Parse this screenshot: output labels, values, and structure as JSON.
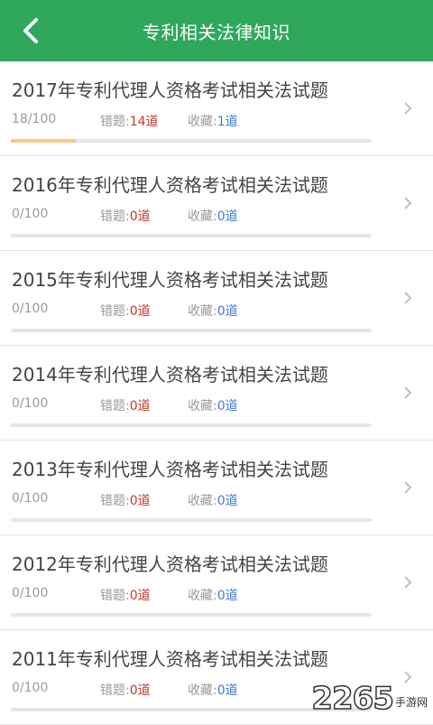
{
  "header": {
    "title": "专利相关法律知识",
    "back_icon": "chevron-left-icon",
    "background_color": "#2fa85c"
  },
  "labels": {
    "wrong": "错题:",
    "fav": "收藏:"
  },
  "items": [
    {
      "title": "2017年专利代理人资格考试相关法试题",
      "progress_text": "18/100",
      "progress_fraction": 0.18,
      "wrong": "14道",
      "fav": "1道"
    },
    {
      "title": "2016年专利代理人资格考试相关法试题",
      "progress_text": "0/100",
      "progress_fraction": 0,
      "wrong": "0道",
      "fav": "0道"
    },
    {
      "title": "2015年专利代理人资格考试相关法试题",
      "progress_text": "0/100",
      "progress_fraction": 0,
      "wrong": "0道",
      "fav": "0道"
    },
    {
      "title": "2014年专利代理人资格考试相关法试题",
      "progress_text": "0/100",
      "progress_fraction": 0,
      "wrong": "0道",
      "fav": "0道"
    },
    {
      "title": "2013年专利代理人资格考试相关法试题",
      "progress_text": "0/100",
      "progress_fraction": 0,
      "wrong": "0道",
      "fav": "0道"
    },
    {
      "title": "2012年专利代理人资格考试相关法试题",
      "progress_text": "0/100",
      "progress_fraction": 0,
      "wrong": "0道",
      "fav": "0道"
    },
    {
      "title": "2011年专利代理人资格考试相关法试题",
      "progress_text": "0/100",
      "progress_fraction": 0,
      "wrong": "0道",
      "fav": "0道"
    }
  ],
  "watermark": {
    "number": "2265",
    "suffix": "手游网"
  },
  "colors": {
    "wrong_value": "#c0392b",
    "fav_value": "#3b7dd8",
    "progress_fill": "#f6c98a"
  }
}
